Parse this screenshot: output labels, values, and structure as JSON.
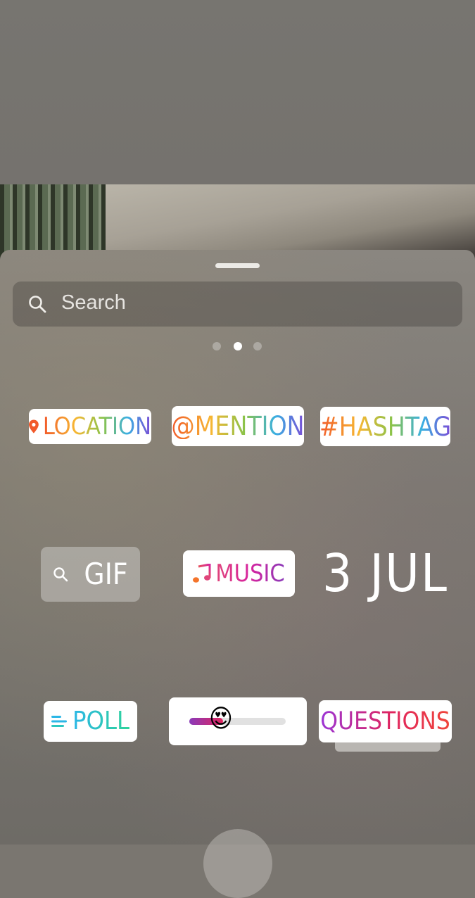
{
  "search": {
    "placeholder": "Search"
  },
  "pager": {
    "page_count": 3,
    "active_page": 2
  },
  "stickers": {
    "location": {
      "label": "LOCATION",
      "icon": "location-pin-icon"
    },
    "mention": {
      "label": "@MENTION"
    },
    "hashtag": {
      "label": "#HASHTAG"
    },
    "gif": {
      "label": "GIF",
      "icon": "search-icon"
    },
    "music": {
      "label": "MUSIC",
      "icon": "music-note-icon"
    },
    "date": {
      "label": "3 JUL"
    },
    "poll": {
      "label": "POLL",
      "icon": "poll-lines-icon"
    },
    "slider": {
      "emoji": "😍",
      "icon": "heart-eyes-emoji-icon",
      "level": 0.35
    },
    "questions": {
      "label": "QUESTIONS"
    }
  },
  "colors": {
    "rainbow": [
      "#f1592a",
      "#f7b733",
      "#8bc34a",
      "#3ab0e2",
      "#7b4cd6"
    ],
    "music": [
      "#f4742b",
      "#d6249f",
      "#8a3ab9"
    ],
    "poll": [
      "#2bb6e6",
      "#2fd39b"
    ],
    "questions": [
      "#9b35d6",
      "#e0245e",
      "#f0463a"
    ],
    "slider": [
      "#8a3ab9",
      "#e0245e"
    ]
  }
}
